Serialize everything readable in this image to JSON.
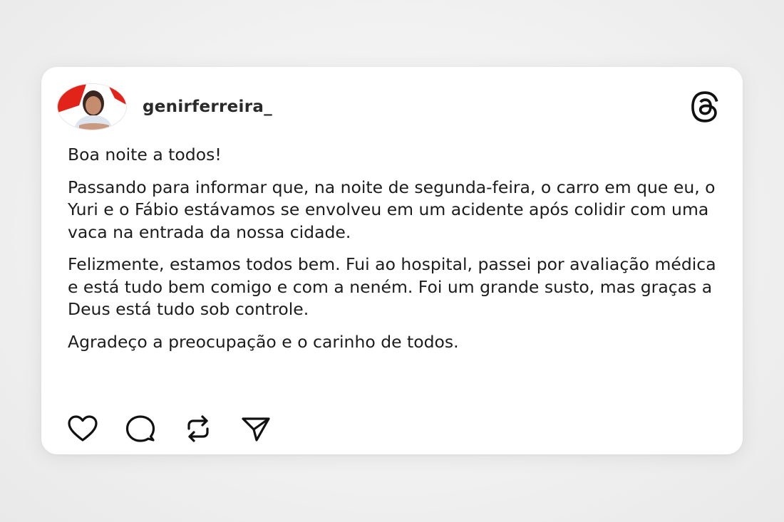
{
  "post": {
    "username": "genirferreira_",
    "paragraphs": [
      "Boa noite a todos!",
      "Passando para informar que, na noite de segunda-feira, o carro em que eu, o Yuri e o Fábio estávamos se envolveu em um acidente após colidir com uma vaca na entrada da nossa cidade.",
      "Felizmente, estamos todos bem. Fui ao hospital, passei por avaliação médica e está tudo bem comigo e com a neném. Foi um grande susto, mas graças a Deus está tudo sob controle.",
      "Agradeço a preocupação e o carinho de todos."
    ]
  },
  "icons": {
    "brand": "threads-logo-icon",
    "actions": [
      "heart-icon",
      "comment-icon",
      "repost-icon",
      "share-icon"
    ]
  },
  "colors": {
    "card_background": "#ffffff",
    "page_background": "#f1f1f1",
    "text": "#1c1c1c",
    "avatar_accent": "#e2231a"
  }
}
